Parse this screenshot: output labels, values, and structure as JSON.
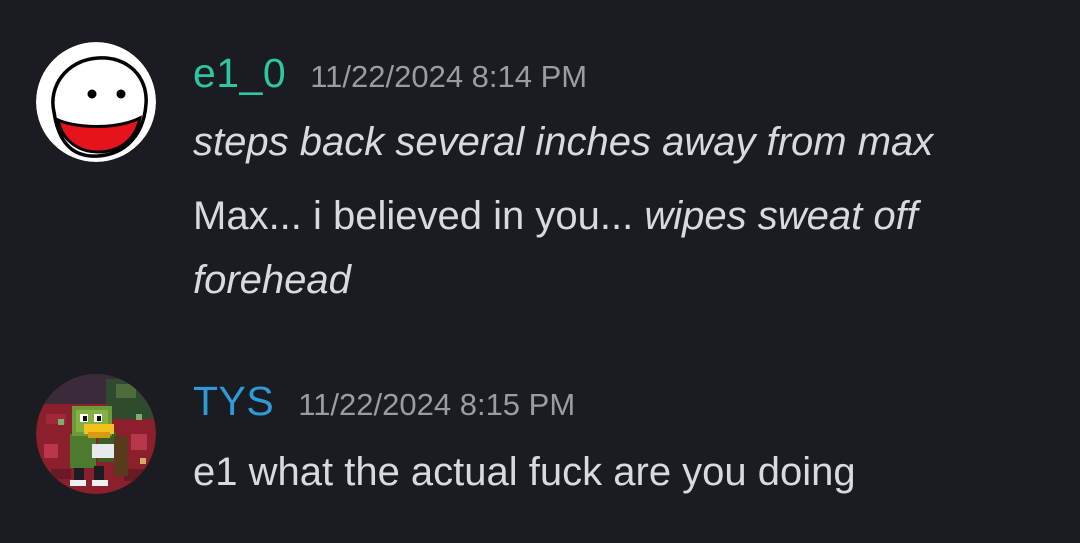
{
  "messages": [
    {
      "username": "e1_0",
      "username_color": "#2fc6a2",
      "timestamp": "11/22/2024 8:14 PM",
      "avatar_icon": "smiley-face-avatar",
      "lines": [
        {
          "italic_text": "steps back several inches away from max"
        },
        {
          "plain_text": "Max... i believed in you... ",
          "italic_text": "wipes sweat off"
        },
        {
          "italic_text": "forehead"
        }
      ]
    },
    {
      "username": "TYS",
      "username_color": "#2d9bd7",
      "timestamp": "11/22/2024 8:15 PM",
      "avatar_icon": "pixel-art-character-avatar",
      "lines": [
        {
          "plain_text": "e1 what the actual fuck are you doing"
        }
      ]
    }
  ]
}
